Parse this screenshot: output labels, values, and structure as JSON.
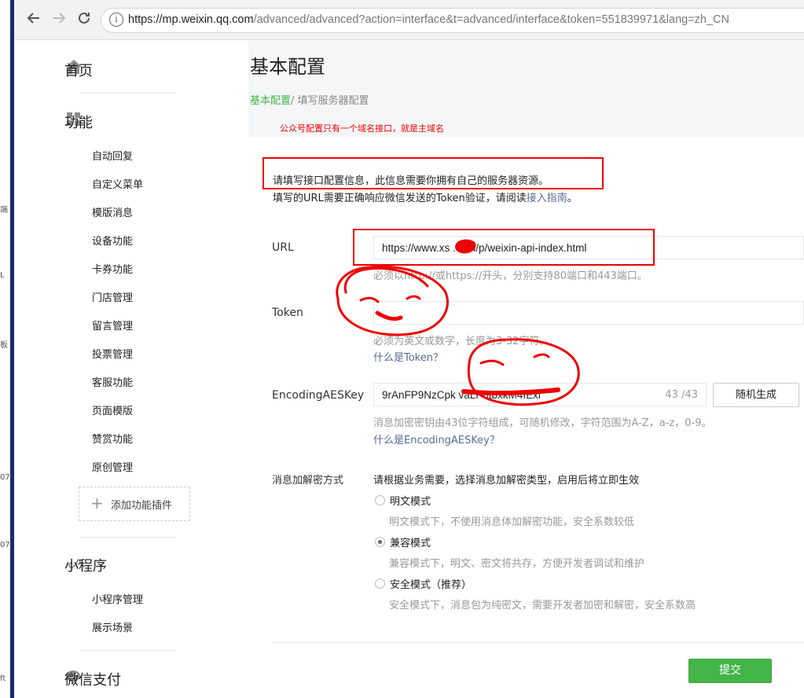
{
  "browser": {
    "url_host": "https://mp.weixin.qq.com",
    "url_rest": "/advanced/advanced?action=interface&t=advanced/interface&token=551839971&lang=zh_CN",
    "info_glyph": "i"
  },
  "left_strip": [
    "端",
    "L",
    "板",
    "07",
    "07",
    "ft"
  ],
  "sidebar": {
    "home": "首页",
    "functions": {
      "title": "功能",
      "items": [
        "自动回复",
        "自定义菜单",
        "模版消息",
        "设备功能",
        "卡券功能",
        "门店管理",
        "留言管理",
        "投票管理",
        "客服功能",
        "页面模版",
        "赞赏功能",
        "原创管理"
      ],
      "add_plugin": "添加功能插件"
    },
    "miniprogram": {
      "title": "小程序",
      "items": [
        "小程序管理",
        "展示场景"
      ]
    },
    "pay": "微信支付"
  },
  "main": {
    "title": "基本配置",
    "breadcrumb_first": "基本配置",
    "breadcrumb_sep": "/ ",
    "breadcrumb_second": "填写服务器配置",
    "annotation": "公众号配置只有一个域名接口，就是主域名",
    "intro_line1": "请填写接口配置信息，此信息需要你拥有自己的服务器资源。",
    "intro_line2_pre": "填写的URL需要正确响应微信发送的Token验证，请阅读",
    "intro_line2_link": "接入指南",
    "intro_line2_post": "。",
    "url": {
      "label": "URL",
      "value": "https://www.xs        .com/p/weixin-api-index.html",
      "hint": "必须以http://或https://开头，分别支持80端口和443端口。"
    },
    "token": {
      "label": "Token",
      "value": "",
      "hint": "必须为英文或数字，长度为3-32字符。",
      "link": "什么是Token？"
    },
    "aes": {
      "label": "EncodingAESKey",
      "value": "9rAnFP9NzCpk                    vaLP8tbxkM4fExl",
      "count": "43 /43",
      "random_button": "随机生成",
      "hint": "消息加密密钥由43位字符组成，可随机修改，字符范围为A-Z，a-z，0-9。",
      "link": "什么是EncodingAESKey？"
    },
    "encrypt": {
      "label": "消息加解密方式",
      "intro": "请根据业务需要，选择消息加解密类型，启用后将立即生效",
      "options": [
        {
          "label": "明文模式",
          "desc": "明文模式下，不使用消息体加解密功能，安全系数较低",
          "selected": false
        },
        {
          "label": "兼容模式",
          "desc": "兼容模式下，明文、密文将共存，方便开发者调试和维护",
          "selected": true
        },
        {
          "label": "安全模式（推荐）",
          "desc": "安全模式下，消息包为纯密文，需要开发者加密和解密，安全系数高",
          "selected": false
        }
      ]
    },
    "submit": "提交"
  },
  "colors": {
    "accent_green": "#44b549",
    "link_blue": "#576b95",
    "annotation_red": "#ee0000"
  }
}
